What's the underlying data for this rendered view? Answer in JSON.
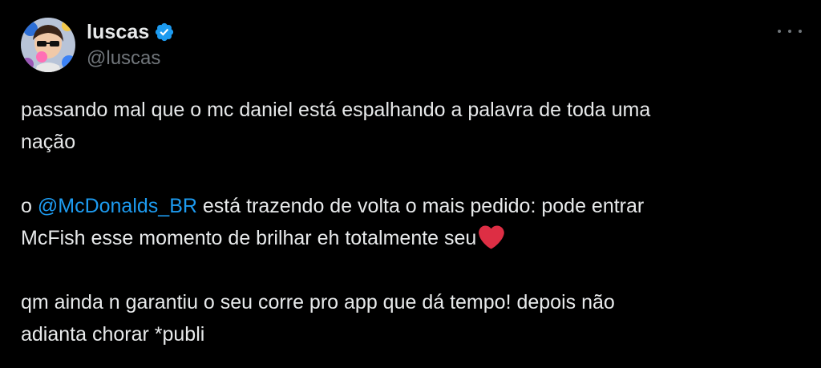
{
  "author": {
    "display_name": "luscas",
    "handle": "@luscas",
    "verified": true,
    "avatar_icon": "avatar-cartoon-sunglasses"
  },
  "menu": {
    "icon": "more-horizontal-icon"
  },
  "tweet": {
    "line1": "passando mal que o mc daniel está espalhando a palavra de toda uma",
    "line2": "nação",
    "p2_prefix": "o ",
    "mention": "@McDonalds_BR",
    "p2_after_mention": " está trazendo de volta o mais pedido: pode entrar",
    "p2_line2": "McFish esse momento de brilhar eh totalmente seu",
    "emoji": "red-heart",
    "p3_line1": "qm ainda n garantiu o seu corre pro app que dá tempo! depois não",
    "p3_line2": "adianta chorar *publi"
  },
  "colors": {
    "background": "#000000",
    "text": "#e7e9ea",
    "secondary": "#71767b",
    "link": "#1d9bf0",
    "verified": "#1d9bf0",
    "heart": "#dd2e44"
  }
}
